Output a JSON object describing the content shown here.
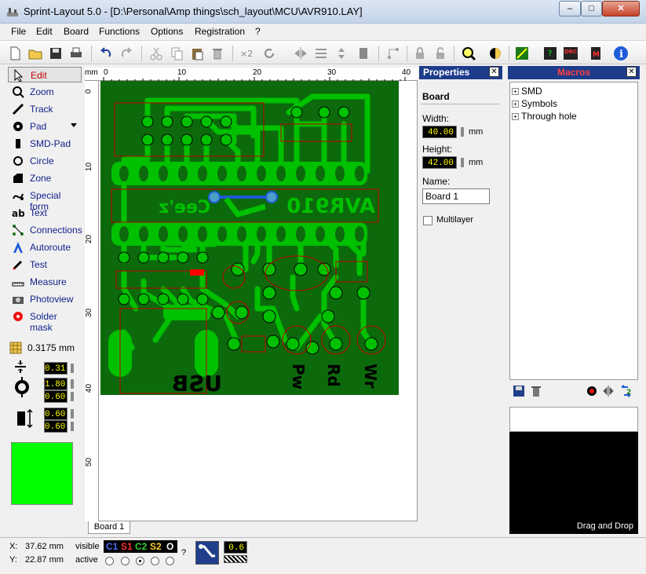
{
  "window": {
    "title": "Sprint-Layout 5.0 - [D:\\Personal\\Amp things\\sch_layout\\MCU\\AVR910.LAY]"
  },
  "menu": [
    "File",
    "Edit",
    "Board",
    "Functions",
    "Options",
    "Registration",
    "?"
  ],
  "tools": [
    "Edit",
    "Zoom",
    "Track",
    "Pad",
    "SMD-Pad",
    "Circle",
    "Zone",
    "Special form",
    "Text",
    "Connections",
    "Autoroute",
    "Test",
    "Measure",
    "Photoview",
    "Solder mask"
  ],
  "active_tool": "Edit",
  "grid": "0.3175 mm",
  "params": {
    "track_width": "0.31",
    "pad_outer": "1.80",
    "pad_inner": "0.60",
    "smd_w": "0.60",
    "smd_h": "0.60"
  },
  "colors": {
    "current_layer": "#00ff00",
    "board": "#0c6a0c",
    "copper": "#00c000"
  },
  "rulers": {
    "unit": "mm",
    "top": [
      "0",
      "10",
      "20",
      "30",
      "40"
    ],
    "left": [
      "0",
      "10",
      "20",
      "30",
      "40",
      "50"
    ]
  },
  "board_text": {
    "usb": "USB",
    "avr": "AVR910",
    "cee": "Cee'z",
    "pw": "Pw",
    "rd": "Rd",
    "wr": "Wr"
  },
  "tabs": [
    "Board 1"
  ],
  "properties": {
    "title": "Properties",
    "section": "Board",
    "width_label": "Width:",
    "width_value": "40.00",
    "height_label": "Height:",
    "height_value": "42.00",
    "unit": "mm",
    "name_label": "Name:",
    "name_value": "Board 1",
    "multilayer_label": "Multilayer"
  },
  "macros": {
    "title": "Macros",
    "tree": [
      "SMD",
      "Symbols",
      "Through hole"
    ],
    "drag_drop": "Drag and Drop"
  },
  "status": {
    "x_label": "X:",
    "x_value": "37.62 mm",
    "y_label": "Y:",
    "y_value": "22.87 mm",
    "visible_label": "visible",
    "active_label": "active",
    "layers": [
      "C1",
      "S1",
      "C2",
      "S2",
      "O"
    ],
    "help": "?",
    "zoom_value": "0.6"
  }
}
